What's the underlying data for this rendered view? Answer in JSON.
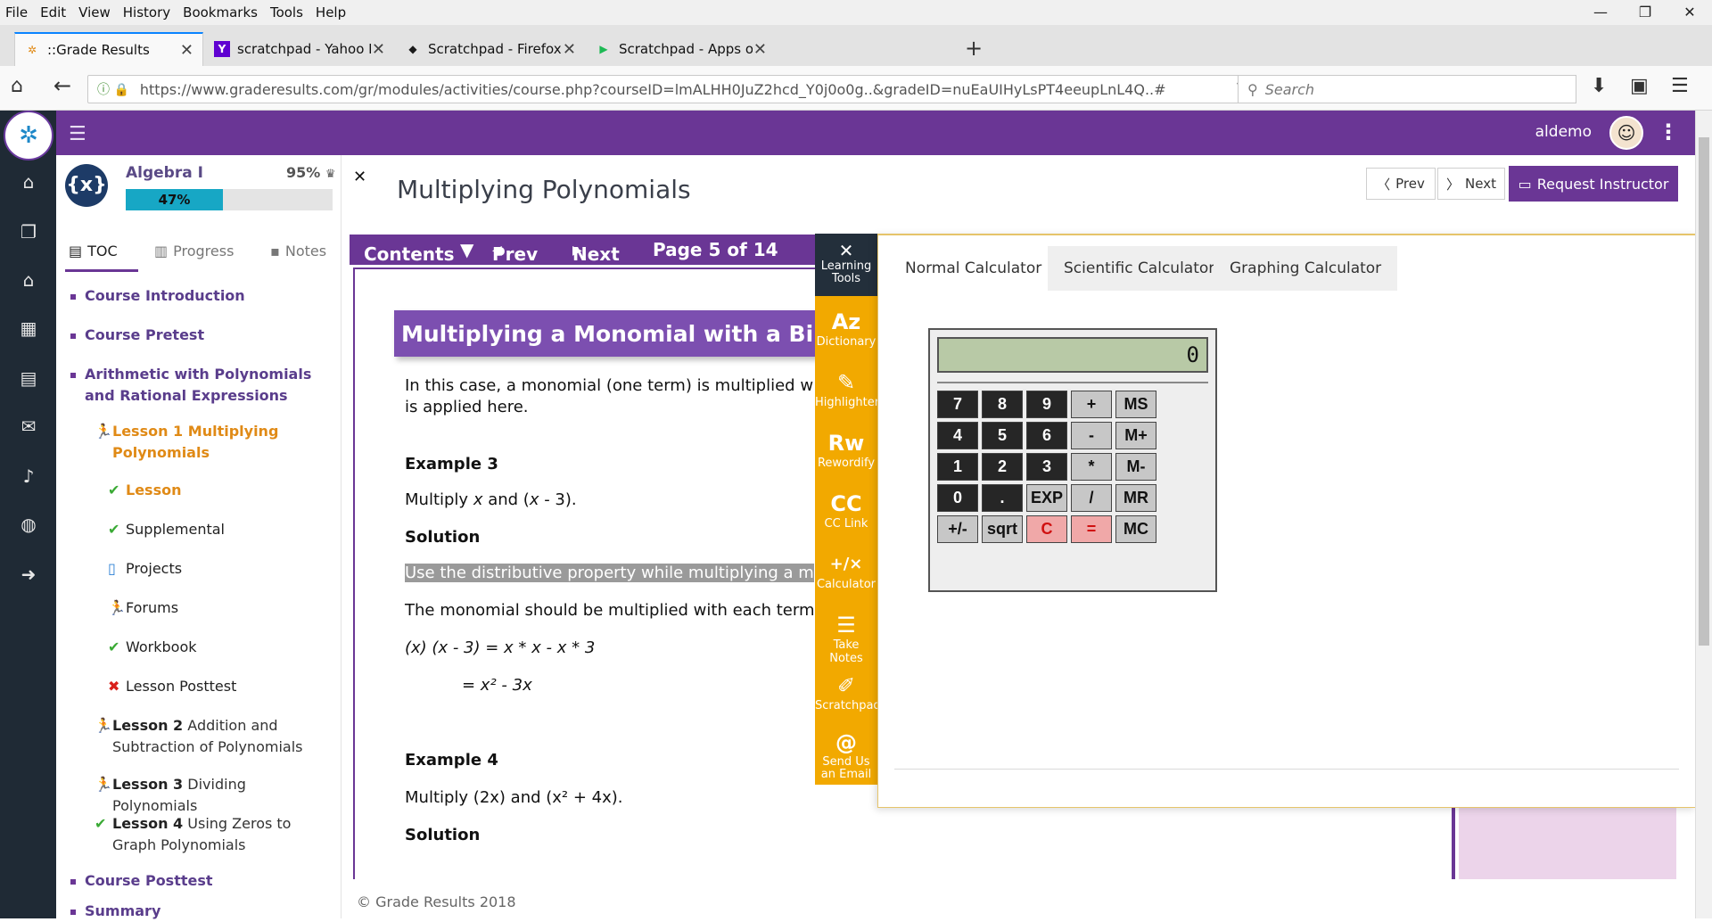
{
  "browser": {
    "menu": [
      "File",
      "Edit",
      "View",
      "History",
      "Bookmarks",
      "Tools",
      "Help"
    ],
    "tabs": [
      {
        "title": "::Grade Results",
        "icon": "graderesults-favicon"
      },
      {
        "title": "scratchpad - Yahoo India ...",
        "icon": "yahoo-favicon"
      },
      {
        "title": "Scratchpad - Firefox Deve...",
        "icon": "firefox-dev-favicon"
      },
      {
        "title": "Scratchpad - Apps on Go...",
        "icon": "google-play-favicon"
      }
    ],
    "url": "https://www.graderesults.com/gr/modules/activities/course.php?courseID=lmALHH0JuZ2hcd_Y0j0o0g..&gradeID=nuEaUIHyLsPT4eeupLnL4Q..#",
    "search_placeholder": "Search"
  },
  "header": {
    "username": "aldemo"
  },
  "course": {
    "icon_text": "{x}",
    "title": "Algebra I",
    "score": "95%",
    "progress_label": "47%",
    "progress_fraction": 0.47,
    "tabs": [
      "TOC",
      "Progress",
      "Notes"
    ]
  },
  "toc": {
    "course_intro": "Course Introduction",
    "course_pretest": "Course Pretest",
    "unit": "Arithmetic with Polynomials and Rational Expressions",
    "lesson1_prefix": "Lesson 1",
    "lesson1_title": "Multiplying Polynomials",
    "sub_lesson": "Lesson",
    "sub_supplemental": "Supplemental",
    "sub_projects": "Projects",
    "sub_forums": "Forums",
    "sub_workbook": "Workbook",
    "sub_posttest": "Lesson Posttest",
    "lesson2_prefix": "Lesson 2",
    "lesson2_title": "Addition and Subtraction of Polynomials",
    "lesson3_prefix": "Lesson 3",
    "lesson3_title": "Dividing Polynomials",
    "lesson4_prefix": "Lesson 4",
    "lesson4_title": "Using Zeros to Graph Polynomials",
    "course_posttest": "Course Posttest",
    "summary": "Summary"
  },
  "main": {
    "page_title": "Multiplying Polynomials",
    "prev": "Prev",
    "next": "Next",
    "request_instructor": "Request Instructor",
    "contents_label": "Contents",
    "contents_prev": "Prev",
    "contents_next": "Next",
    "page_indicator": "Page 5 of 14",
    "lesson_heading": "Multiplying a Monomial with a Binc",
    "para1_line1": "In this case, a monomial (one term) is multiplied w",
    "para1_line2": "is applied here.",
    "example3": "Example 3",
    "example3_text_a": "Multiply ",
    "example3_text_x": "x",
    "example3_text_b": " and (",
    "example3_text_x2": "x",
    "example3_text_c": " - 3).",
    "solution": "Solution",
    "highlighted": "Use the distributive property while multiplying a m",
    "monomial_text": "The monomial should be multiplied with each term",
    "eq1": "(x) (x - 3) = x * x - x * 3",
    "eq2": "= x² - 3x",
    "example4": "Example 4",
    "example4_text": "Multiply (2x) and (x² + 4x).",
    "solution2": "Solution",
    "footer": "© Grade Results 2018"
  },
  "learning_tools": {
    "header": "Learning Tools",
    "items": [
      {
        "label": "Dictionary",
        "glyph": "Az"
      },
      {
        "label": "Highlighter",
        "glyph": "✎"
      },
      {
        "label": "Rewordify",
        "glyph": "Rw"
      },
      {
        "label": "CC Link",
        "glyph": "CC"
      },
      {
        "label": "Calculator",
        "glyph": "+/×"
      },
      {
        "label": "Take Notes",
        "glyph": "☰"
      },
      {
        "label": "Scratchpad",
        "glyph": "✐"
      },
      {
        "label": "Send Us an Email",
        "glyph": "@"
      }
    ]
  },
  "calculator": {
    "tabs": [
      "Normal Calculator",
      "Scientific Calculator",
      "Graphing Calculator"
    ],
    "display": "0",
    "keys": [
      [
        "7",
        "8",
        "9",
        "+",
        "MS"
      ],
      [
        "4",
        "5",
        "6",
        "-",
        "M+"
      ],
      [
        "1",
        "2",
        "3",
        "*",
        "M-"
      ],
      [
        "0",
        ".",
        "EXP",
        "/",
        "MR"
      ],
      [
        "+/-",
        "sqrt",
        "C",
        "=",
        "MC"
      ]
    ]
  }
}
